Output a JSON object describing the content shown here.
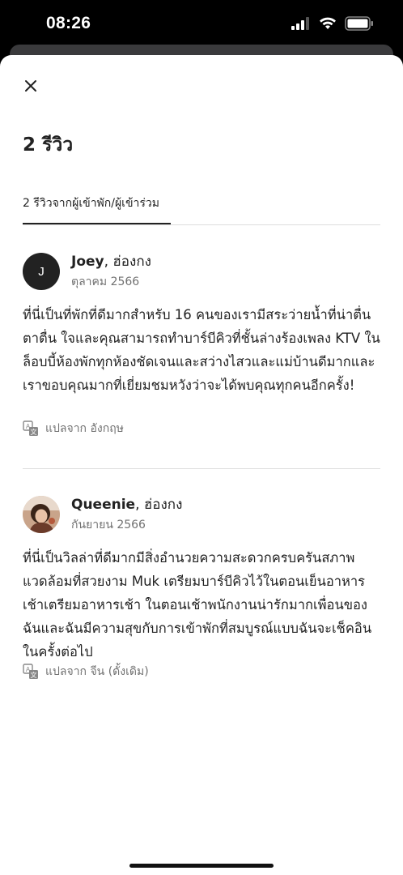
{
  "status_bar": {
    "time": "08:26"
  },
  "header": {
    "title": "2 รีวิว"
  },
  "tabs": [
    {
      "label": "2 รีวิวจากผู้เข้าพัก/ผู้เข้าร่วม"
    }
  ],
  "reviews": [
    {
      "avatar_initial": "J",
      "name": "Joey",
      "location": ", ฮ่องกง",
      "date": "ตุลาคม 2566",
      "text": "ที่นี่เป็นที่พักที่ดีมากสำหรับ 16 คนของเรามีสระว่ายน้ำที่น่าตื่นตาตื่น ใจและคุณสามารถทำบาร์บีคิวที่ชั้นล่างร้องเพลง KTV ในล็อบบี้ห้องพักทุกห้องชัดเจนและสว่างไสวและแม่บ้านดีมากและเราขอบคุณมากที่เยี่ยมชมหวังว่าจะได้พบคุณทุกคนอีกครั้ง!",
      "translated_from": "แปลจาก อังกฤษ"
    },
    {
      "name": "Queenie",
      "location": ", ฮ่องกง",
      "date": "กันยายน 2566",
      "text": "ที่นี่เป็นวิลล่าที่ดีมากมีสิ่งอำนวยความสะดวกครบครันสภาพแวดล้อมที่สวยงาม Muk เตรียมบาร์บีคิวไว้ในตอนเย็นอาหารเช้าเตรียมอาหารเช้า ในตอนเช้าพนักงานน่ารักมากเพื่อนของฉันและฉันมีความสุขกับการเข้าพักที่สมบูรณ์แบบฉันจะเช็คอินในครั้งต่อไป",
      "translated_from": "แปลจาก จีน (ดั้งเดิม)"
    }
  ]
}
